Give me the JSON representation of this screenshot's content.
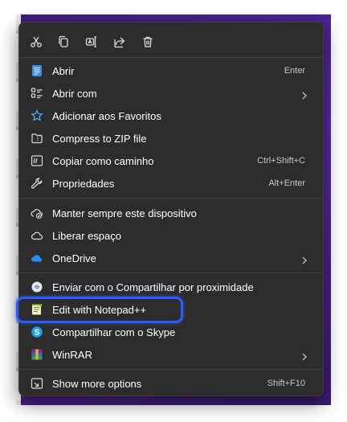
{
  "toolbar": {
    "buttons": [
      {
        "name": "cut-icon"
      },
      {
        "name": "copy-icon"
      },
      {
        "name": "rename-icon"
      },
      {
        "name": "share-icon"
      },
      {
        "name": "delete-icon"
      }
    ]
  },
  "menu": {
    "open": {
      "label": "Abrir",
      "shortcut": "Enter"
    },
    "open_with": {
      "label": "Abrir com"
    },
    "favorites": {
      "label": "Adicionar aos Favoritos"
    },
    "zip": {
      "label": "Compress to ZIP file"
    },
    "copy_path": {
      "label": "Copiar como caminho",
      "shortcut": "Ctrl+Shift+C"
    },
    "properties": {
      "label": "Propriedades",
      "shortcut": "Alt+Enter"
    },
    "keep_device": {
      "label": "Manter sempre este dispositivo"
    },
    "free_space": {
      "label": "Liberar espaço"
    },
    "onedrive": {
      "label": "OneDrive"
    },
    "nearby_share": {
      "label": "Enviar com o Compartilhar por proximidade"
    },
    "notepadpp": {
      "label": "Edit with Notepad++"
    },
    "skype": {
      "label": "Compartilhar com o Skype"
    },
    "winrar": {
      "label": "WinRAR"
    },
    "more_options": {
      "label": "Show more options",
      "shortcut": "Shift+F10"
    }
  },
  "colors": {
    "menu_bg": "#2c2c2c",
    "highlight": "#2b5cff",
    "accent_blue": "#4aa3ff"
  }
}
